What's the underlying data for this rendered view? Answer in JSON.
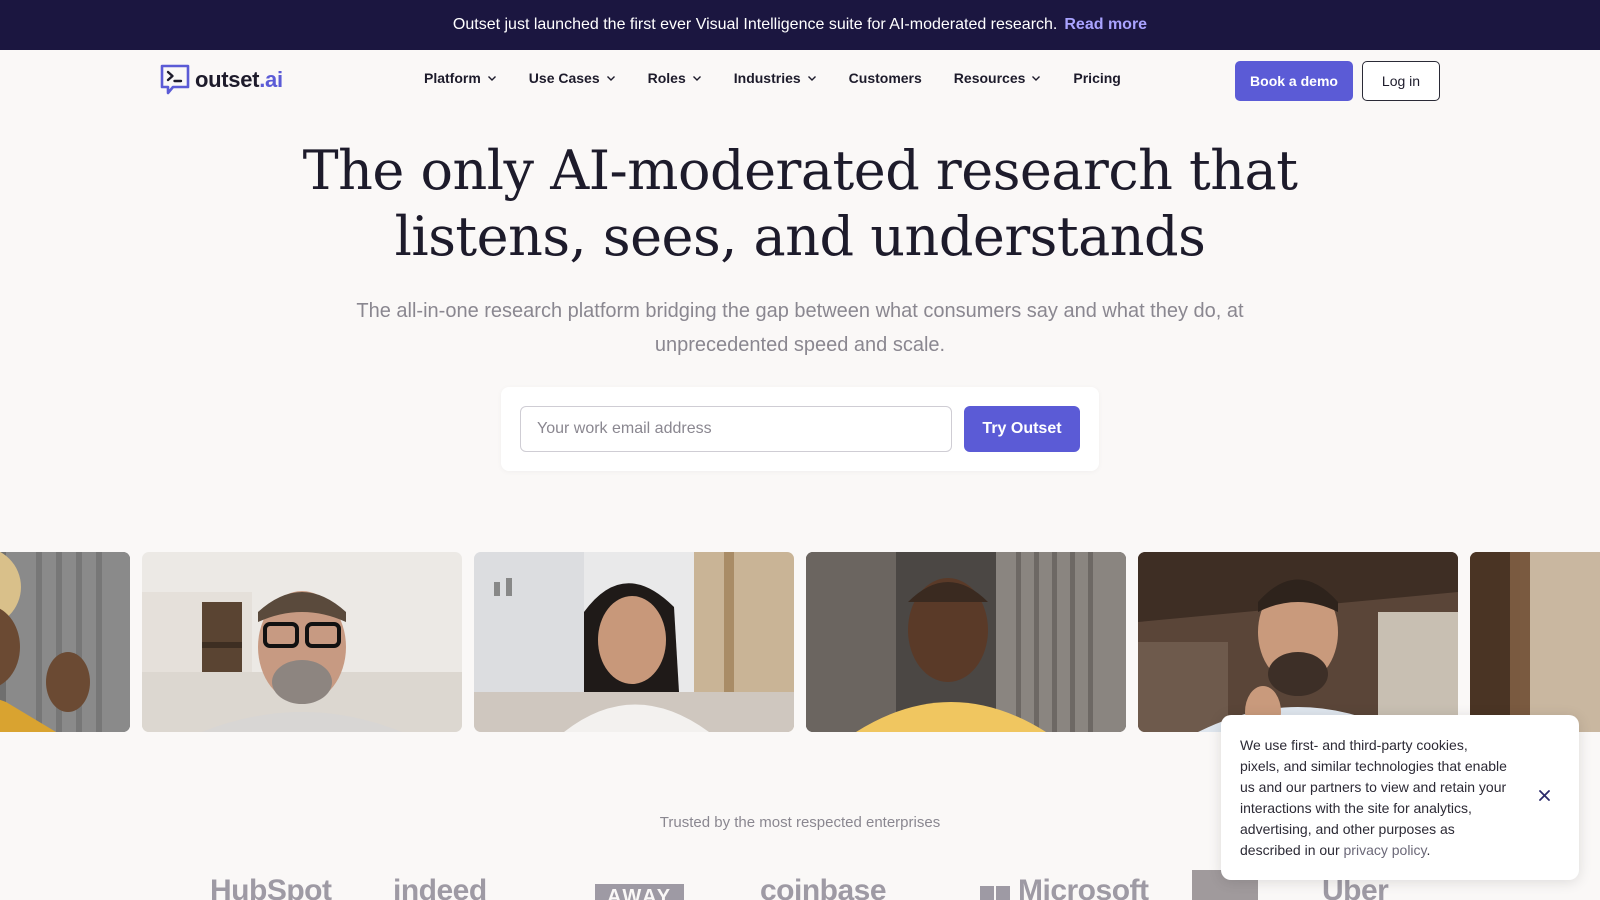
{
  "announcement": {
    "text": "Outset just launched the first ever Visual Intelligence suite for AI-moderated research.",
    "link": "Read more"
  },
  "logo": {
    "name": "outset",
    "suffix": ".ai"
  },
  "nav": {
    "items": [
      {
        "label": "Platform",
        "dropdown": true
      },
      {
        "label": "Use Cases",
        "dropdown": true
      },
      {
        "label": "Roles",
        "dropdown": true
      },
      {
        "label": "Industries",
        "dropdown": true
      },
      {
        "label": "Customers",
        "dropdown": false
      },
      {
        "label": "Resources",
        "dropdown": true
      },
      {
        "label": "Pricing",
        "dropdown": false
      }
    ],
    "book_demo": "Book a demo",
    "login": "Log in"
  },
  "hero": {
    "title_line1": "The only AI-moderated research that",
    "title_line2": "listens, sees, and understands",
    "subtitle_line1": "The all-in-one research platform bridging the gap between what consumers say and what they do, at",
    "subtitle_line2": "unprecedented speed and scale.",
    "email_placeholder": "Your work email address",
    "cta": "Try Outset"
  },
  "trusted": {
    "label": "Trusted by the most respected enterprises",
    "brands": [
      "HubSpot",
      "indeed",
      "AWAY",
      "coinbase",
      "Microsoft",
      "Uber"
    ]
  },
  "cookie": {
    "text": "We use first- and third-party cookies, pixels, and similar technologies that enable us and our partners to view and retain your interactions with the site for analytics, advertising, and other purposes as described in our",
    "link": "privacy policy",
    "end": "."
  },
  "colors": {
    "accent": "#5b5bd6",
    "banner_bg": "#1b1640",
    "page_bg": "#faf8f7"
  }
}
